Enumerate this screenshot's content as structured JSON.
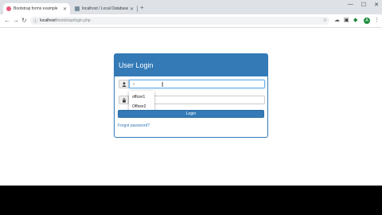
{
  "browser": {
    "tabs": [
      {
        "title": "Bootstrap forms example",
        "active": true
      },
      {
        "title": "localhost / Local Databases / bo",
        "active": false
      }
    ],
    "new_tab_glyph": "+",
    "window_controls": {
      "minimize": "—",
      "maximize": "☐",
      "close": "✕"
    },
    "nav": {
      "back": "←",
      "forward": "→",
      "reload": "↻"
    },
    "address": {
      "host": "localhost",
      "path": "/bootstrap/login.php"
    },
    "avatar_letter": "A",
    "menu_glyph": "⋮"
  },
  "login": {
    "title": "User Login",
    "username_value": "",
    "username_placeholder": "s",
    "password_value": "",
    "submit_label": "Login",
    "forgot_label": "Forgot password?",
    "autocomplete": [
      "officer1",
      "Officer2"
    ]
  },
  "colors": {
    "primary": "#337ab7",
    "tabstrip": "#dee1e6"
  }
}
